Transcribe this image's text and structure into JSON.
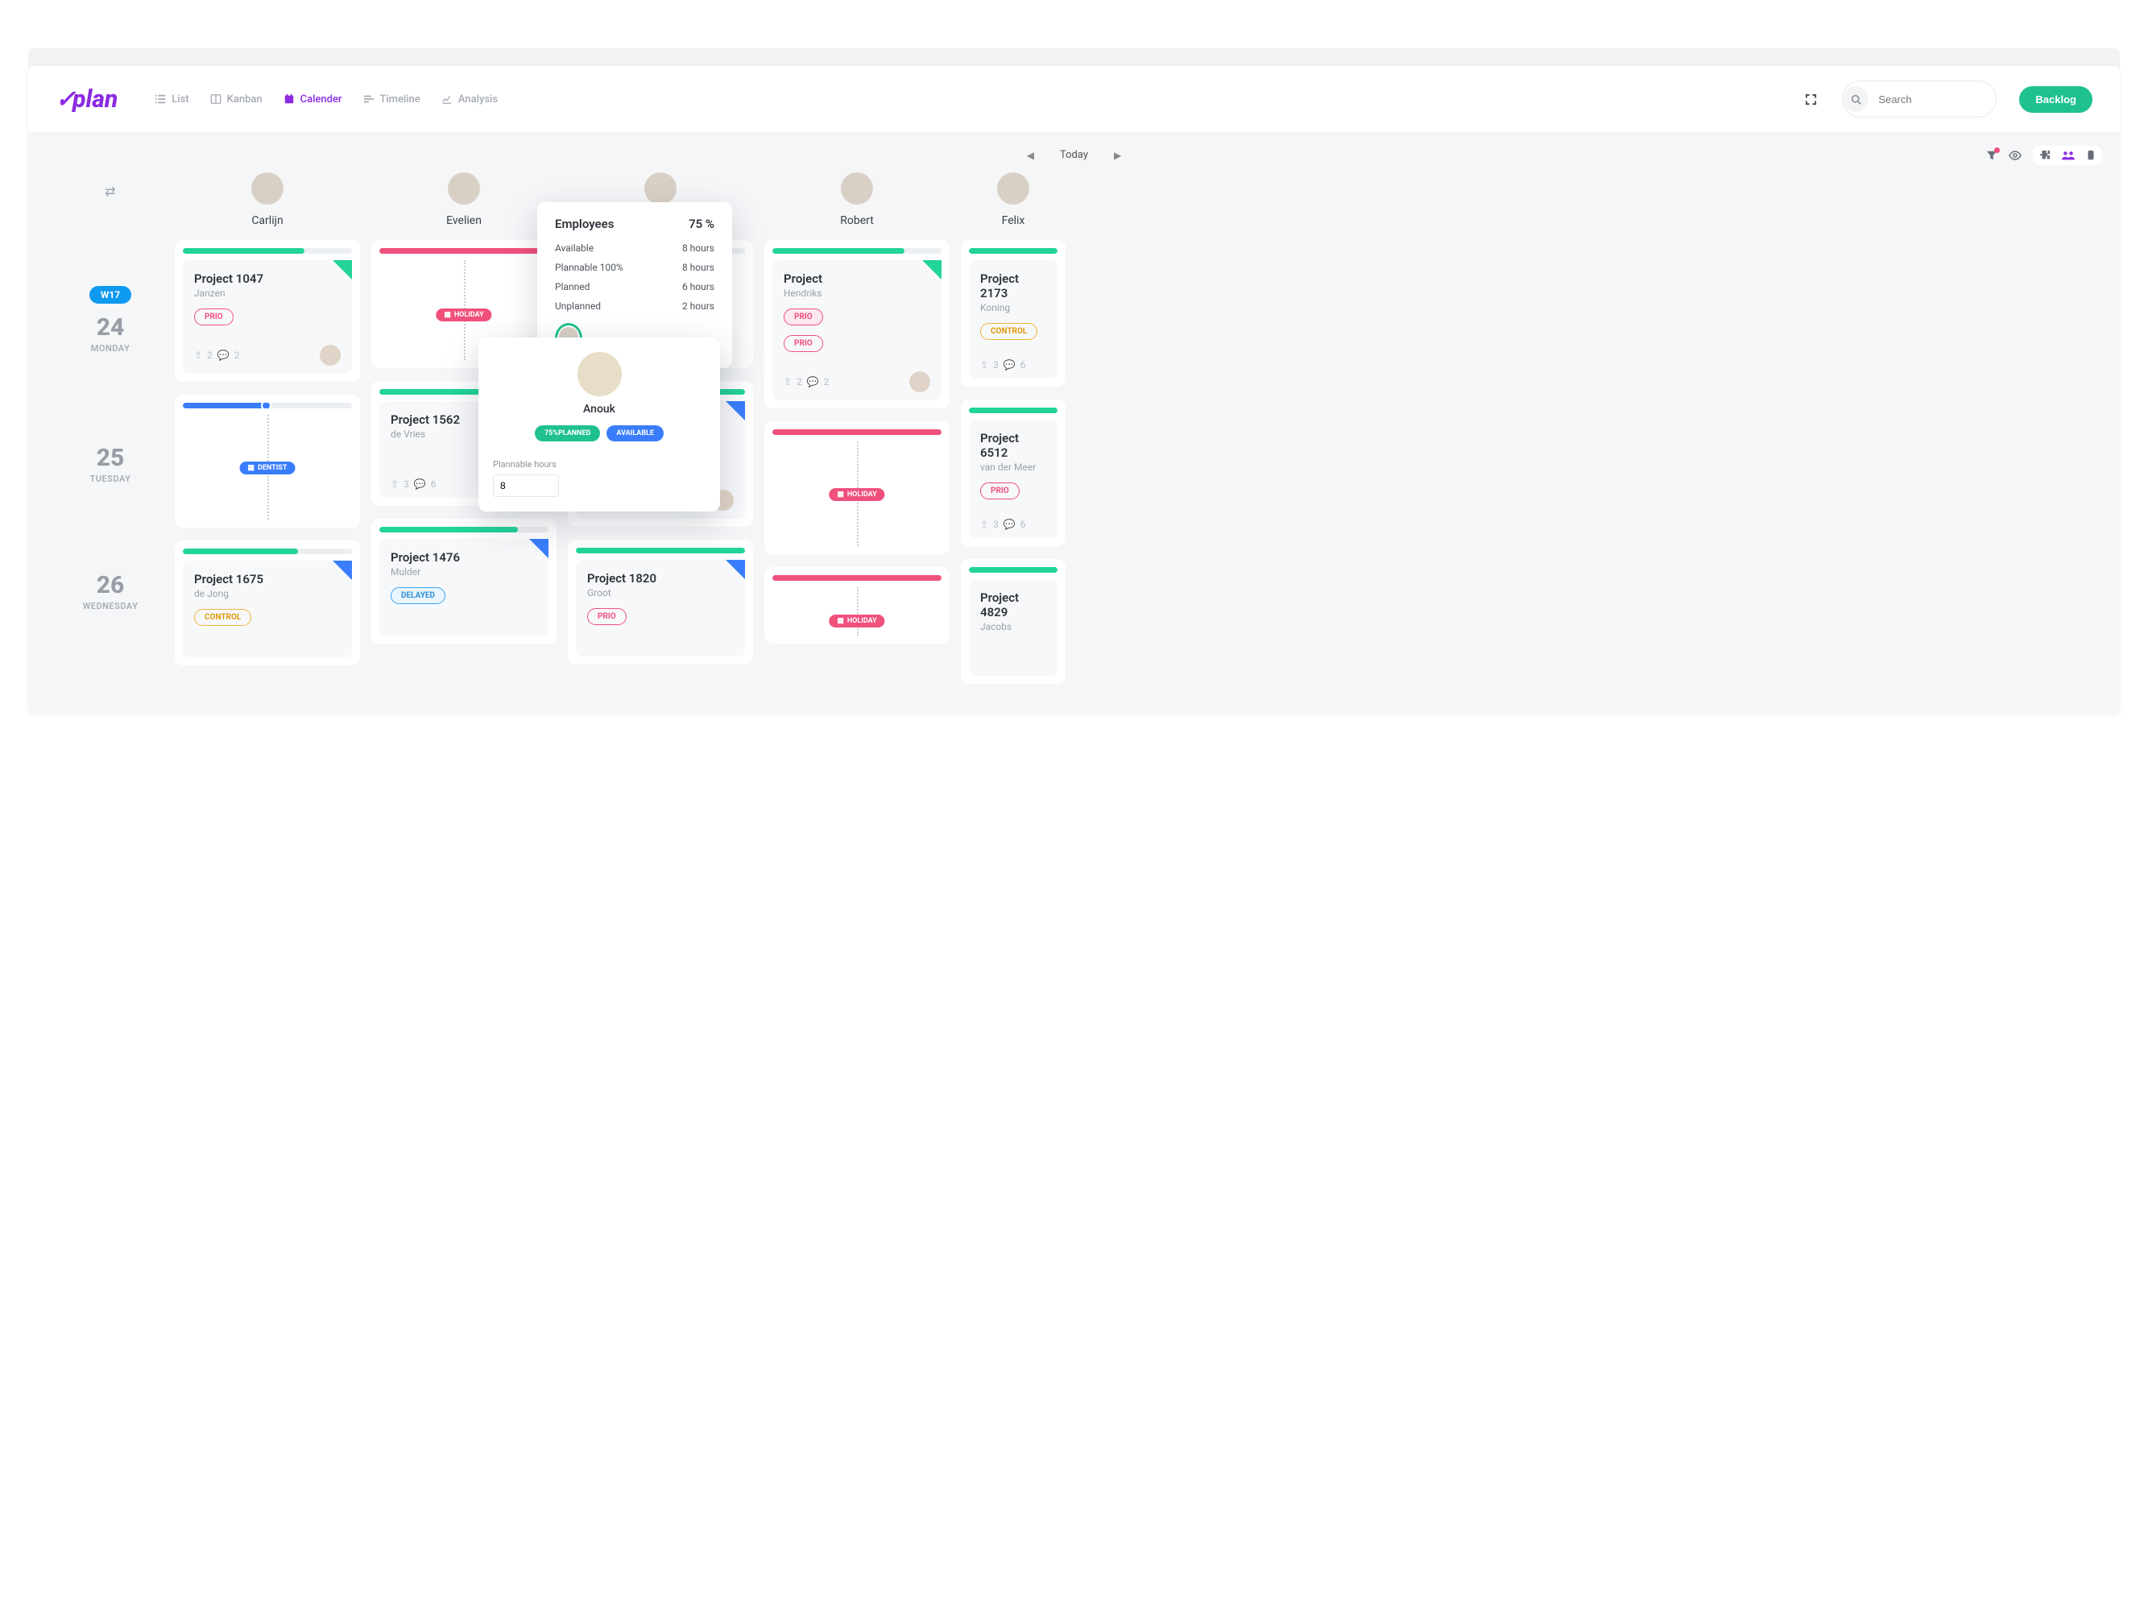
{
  "brand": "plan",
  "views": {
    "list": "List",
    "kanban": "Kanban",
    "calendar": "Calender",
    "timeline": "Timeline",
    "analysis": "Analysis"
  },
  "search_placeholder": "Search",
  "backlog": "Backlog",
  "today": "Today",
  "week_chip": "W17",
  "days": [
    {
      "num": "24",
      "name": "MONDAY"
    },
    {
      "num": "25",
      "name": "TUESDAY"
    },
    {
      "num": "26",
      "name": "WEDNESDAY"
    }
  ],
  "columns": {
    "carlijn": "Carlijn",
    "evelien": "Evelien",
    "anouk": "Anouk",
    "robert": "Robert",
    "felix": "Felix"
  },
  "cards": {
    "c1047": {
      "title": "Project 1047",
      "sub": "Janzen",
      "tag": "PRIO",
      "up": "2",
      "cm": "2"
    },
    "c1562": {
      "title": "Project 1562",
      "sub": "de Vries",
      "up": "3",
      "cm": "6"
    },
    "cHendriks": {
      "title": "Project",
      "sub": "Hendriks",
      "tag": "PRIO",
      "up": "2",
      "cm": "2"
    },
    "c2173": {
      "title": "Project 2173",
      "sub": "Koning",
      "tag": "CONTROL",
      "up": "3",
      "cm": "6"
    },
    "c6512": {
      "title": "Project 6512",
      "sub": "van der Meer",
      "tag": "PRIO",
      "up": "3",
      "cm": "6"
    },
    "c1675": {
      "title": "Project 1675",
      "sub": "de Jong",
      "tag": "CONTROL"
    },
    "c1476": {
      "title": "Project 1476",
      "sub": "Mulder",
      "tag": "DELAYED"
    },
    "c1820": {
      "title": "Project 1820",
      "sub": "Groot",
      "tag": "PRIO"
    },
    "c4829": {
      "title": "Project 4829",
      "sub": "Jacobs"
    }
  },
  "timeline_chips": {
    "holiday": "HOLIDAY",
    "dentist": "DENTIST"
  },
  "popover_employees": {
    "title": "Employees",
    "pct": "75 %",
    "rows": [
      {
        "k": "Available",
        "v": "8 hours"
      },
      {
        "k": "Plannable 100%",
        "v": "8 hours"
      },
      {
        "k": "Planned",
        "v": "6 hours"
      },
      {
        "k": "Unplanned",
        "v": "2 hours"
      }
    ]
  },
  "popover_person": {
    "name": "Anouk",
    "pill1": "75%PLANNED",
    "pill2": "AVAILABLE",
    "label": "Plannable hours",
    "value": "8"
  },
  "prio_overlay": "PRIO"
}
